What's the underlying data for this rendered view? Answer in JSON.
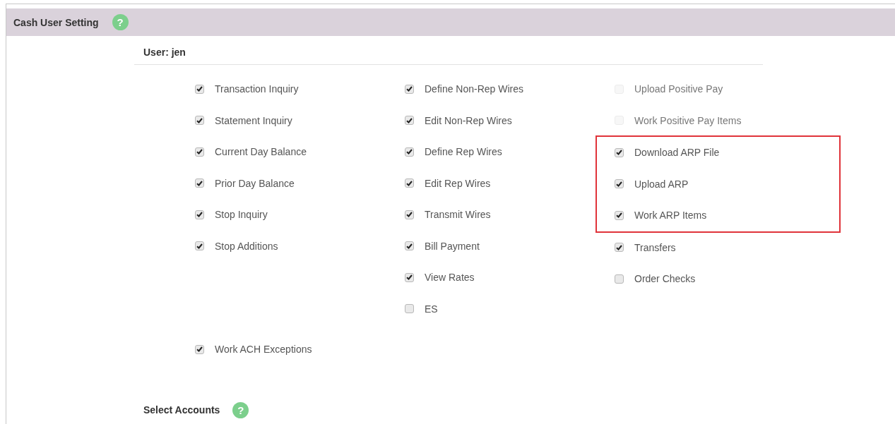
{
  "panel": {
    "title": "Cash User Setting",
    "help": "?"
  },
  "user": {
    "label": "User: jen"
  },
  "columns": [
    {
      "items": [
        {
          "label": "Transaction Inquiry",
          "checked": true,
          "disabled": false,
          "highlighted": false
        },
        {
          "label": "Statement Inquiry",
          "checked": true,
          "disabled": false,
          "highlighted": false
        },
        {
          "label": "Current Day Balance",
          "checked": true,
          "disabled": false,
          "highlighted": false
        },
        {
          "label": "Prior Day Balance",
          "checked": true,
          "disabled": false,
          "highlighted": false
        },
        {
          "label": "Stop Inquiry",
          "checked": true,
          "disabled": false,
          "highlighted": false
        },
        {
          "label": "Stop Additions",
          "checked": true,
          "disabled": false,
          "highlighted": false
        }
      ]
    },
    {
      "items": [
        {
          "label": "Define Non-Rep Wires",
          "checked": true,
          "disabled": false,
          "highlighted": false
        },
        {
          "label": "Edit Non-Rep Wires",
          "checked": true,
          "disabled": false,
          "highlighted": false
        },
        {
          "label": "Define Rep Wires",
          "checked": true,
          "disabled": false,
          "highlighted": false
        },
        {
          "label": "Edit Rep Wires",
          "checked": true,
          "disabled": false,
          "highlighted": false
        },
        {
          "label": "Transmit Wires",
          "checked": true,
          "disabled": false,
          "highlighted": false
        },
        {
          "label": "Bill Payment",
          "checked": true,
          "disabled": false,
          "highlighted": false
        },
        {
          "label": "View Rates",
          "checked": true,
          "disabled": false,
          "highlighted": false
        },
        {
          "label": "ES",
          "checked": false,
          "disabled": false,
          "highlighted": false
        }
      ]
    },
    {
      "items": [
        {
          "label": "Upload Positive Pay",
          "checked": false,
          "disabled": true,
          "highlighted": false
        },
        {
          "label": "Work Positive Pay Items",
          "checked": false,
          "disabled": true,
          "highlighted": false
        },
        {
          "label": "Download ARP File",
          "checked": true,
          "disabled": false,
          "highlighted": true
        },
        {
          "label": "Upload ARP",
          "checked": true,
          "disabled": false,
          "highlighted": true
        },
        {
          "label": "Work ARP Items",
          "checked": true,
          "disabled": false,
          "highlighted": true
        },
        {
          "label": "Transfers",
          "checked": true,
          "disabled": false,
          "highlighted": false
        },
        {
          "label": "Order Checks",
          "checked": false,
          "disabled": false,
          "highlighted": false
        }
      ]
    }
  ],
  "extra_items": [
    {
      "label": "Work ACH Exceptions",
      "checked": true,
      "disabled": false,
      "highlighted": false
    }
  ],
  "accounts": {
    "title": "Select Accounts",
    "help": "?"
  }
}
